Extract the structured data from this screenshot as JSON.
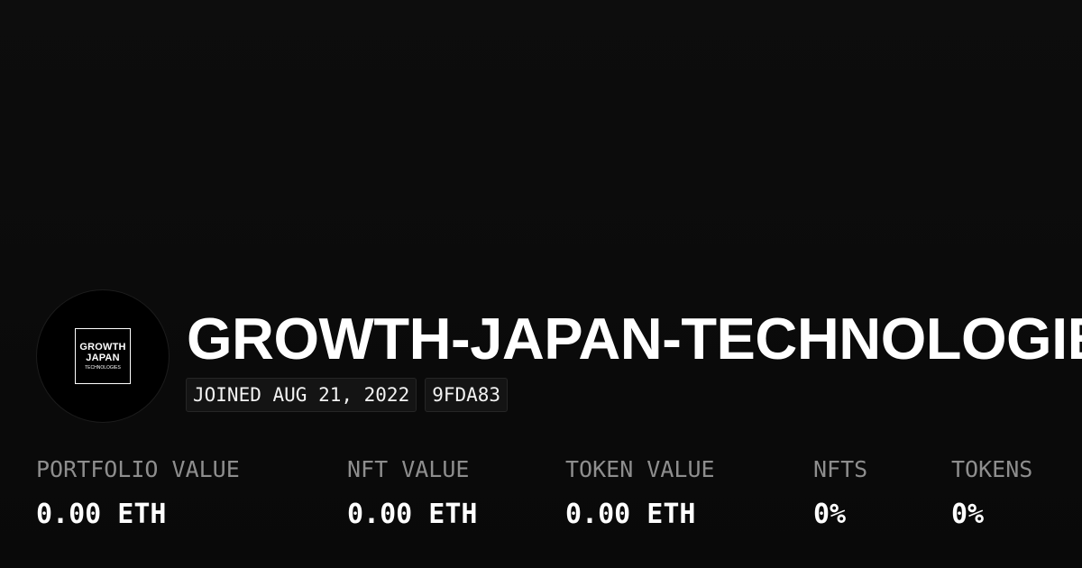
{
  "profile": {
    "avatar_logo": {
      "line1": "GROWTH",
      "line2": "JAPAN",
      "line3": "TECHNOLOGIES"
    },
    "name": "GROWTH-JAPAN-TECHNOLOGIES",
    "joined": "JOINED AUG 21, 2022",
    "address_short": "9FDA83"
  },
  "stats": [
    {
      "label": "PORTFOLIO VALUE",
      "value": "0.00 ETH"
    },
    {
      "label": "NFT VALUE",
      "value": "0.00 ETH"
    },
    {
      "label": "TOKEN VALUE",
      "value": "0.00 ETH"
    },
    {
      "label": "NFTS",
      "value": "0%"
    },
    {
      "label": "TOKENS",
      "value": "0%"
    }
  ],
  "colors": {
    "background": "#0b0b0b",
    "text_primary": "#ffffff",
    "text_muted": "#8e8e8e",
    "chip_background": "#141414"
  }
}
